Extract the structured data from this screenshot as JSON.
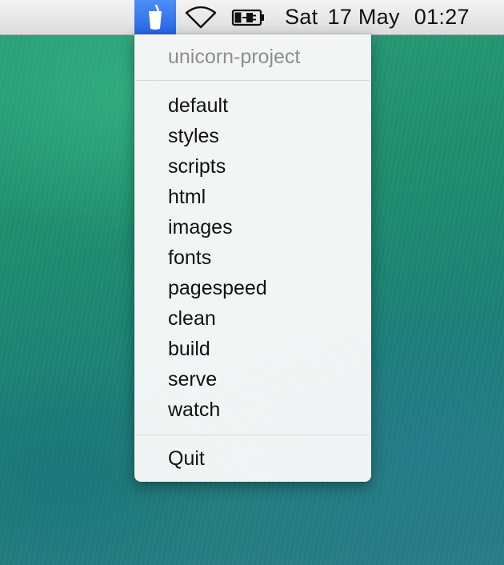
{
  "menubar": {
    "app_icon": "cup-icon",
    "wifi_icon": "wifi-icon",
    "battery_icon": "battery-charging-icon",
    "clock": {
      "day": "Sat",
      "date": "17 May",
      "time": "01:27"
    },
    "accent_color": "#3d7ff2"
  },
  "menu": {
    "header": "unicorn-project",
    "items": [
      {
        "label": "default"
      },
      {
        "label": "styles"
      },
      {
        "label": "scripts"
      },
      {
        "label": "html"
      },
      {
        "label": "images"
      },
      {
        "label": "fonts"
      },
      {
        "label": "pagespeed"
      },
      {
        "label": "clean"
      },
      {
        "label": "build"
      },
      {
        "label": "serve"
      },
      {
        "label": "watch"
      }
    ],
    "quit_label": "Quit"
  }
}
